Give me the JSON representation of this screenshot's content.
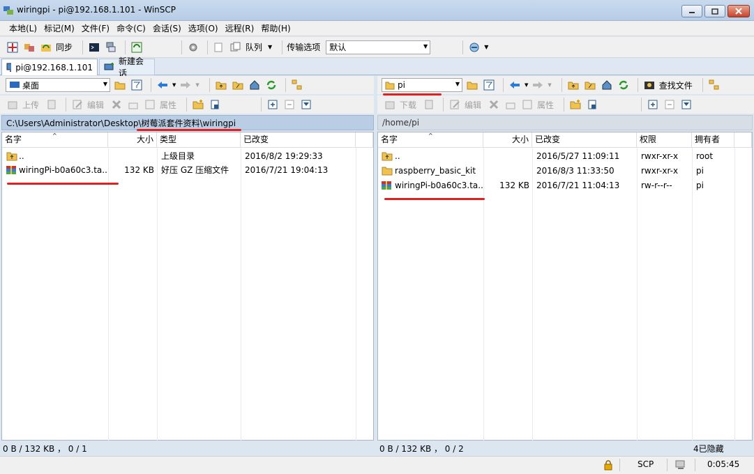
{
  "window": {
    "title": "wiringpi - pi@192.168.1.101 - WinSCP"
  },
  "menu": [
    "本地(L)",
    "标记(M)",
    "文件(F)",
    "命令(C)",
    "会话(S)",
    "选项(O)",
    "远程(R)",
    "帮助(H)"
  ],
  "toolbar": {
    "sync_label": "同步",
    "queue_label": "队列",
    "transfer_label": "传输选项",
    "transfer_value": "默认"
  },
  "tabs": {
    "session": "pi@192.168.1.101",
    "new_session": "新建会话"
  },
  "left": {
    "drive": "桌面",
    "upload": "上传",
    "edit": "编辑",
    "props": "属性",
    "path": "C:\\Users\\Administrator\\Desktop\\树莓派套件资料\\wiringpi",
    "headers": {
      "name": "名字",
      "size": "大小",
      "type": "类型",
      "changed": "已改变"
    },
    "rows": [
      {
        "name": "..",
        "size": "",
        "type": "上级目录",
        "changed": "2016/8/2  19:29:33",
        "icon": "parent-folder-icon"
      },
      {
        "name": "wiringPi-b0a60c3.ta...",
        "size": "132 KB",
        "type": "好压 GZ 压缩文件",
        "changed": "2016/7/21  19:04:13",
        "icon": "archive-icon"
      }
    ],
    "status": "0 B / 132 KB ， 0 / 1"
  },
  "right": {
    "dir": "pi",
    "download": "下载",
    "edit": "编辑",
    "props": "属性",
    "find": "查找文件",
    "path": "/home/pi",
    "headers": {
      "name": "名字",
      "size": "大小",
      "changed": "已改变",
      "rights": "权限",
      "owner": "拥有者"
    },
    "rows": [
      {
        "name": "..",
        "size": "",
        "changed": "2016/5/27 11:09:11",
        "rights": "rwxr-xr-x",
        "owner": "root",
        "icon": "parent-folder-icon"
      },
      {
        "name": "raspberry_basic_kit",
        "size": "",
        "changed": "2016/8/3 11:33:50",
        "rights": "rwxr-xr-x",
        "owner": "pi",
        "icon": "folder-icon"
      },
      {
        "name": "wiringPi-b0a60c3.ta...",
        "size": "132 KB",
        "changed": "2016/7/21 11:04:13",
        "rights": "rw-r--r--",
        "owner": "pi",
        "icon": "archive-icon"
      }
    ],
    "status": "0 B / 132 KB ， 0 / 2",
    "hidden": "4已隐藏"
  },
  "statusbar": {
    "protocol": "SCP",
    "time": "0:05:45"
  },
  "colors": {
    "accent_red": "#e02020",
    "path_active": "#b9cde5",
    "path_inactive": "#d8dee6"
  }
}
